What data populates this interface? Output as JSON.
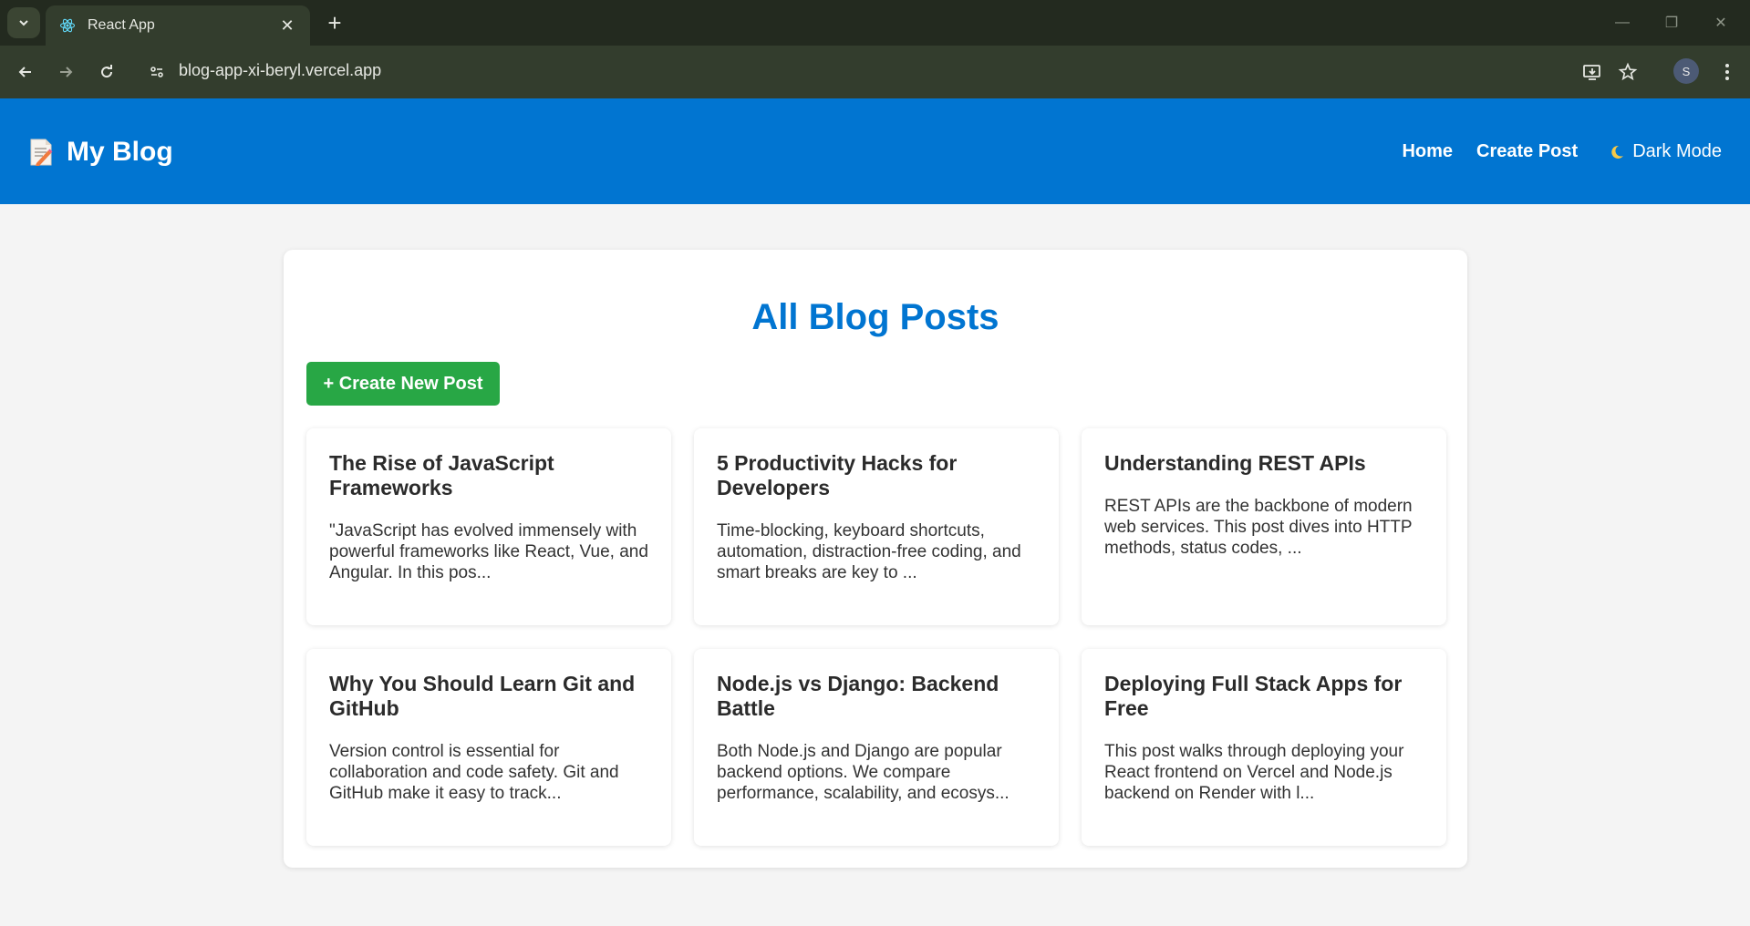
{
  "browser": {
    "tab_title": "React App",
    "url": "blog-app-xi-beryl.vercel.app",
    "profile_initial": "S"
  },
  "header": {
    "brand": "My Blog",
    "nav": {
      "home": "Home",
      "create_post": "Create Post",
      "dark_mode": "Dark Mode"
    }
  },
  "main": {
    "title": "All Blog Posts",
    "create_button": "+ Create New Post",
    "posts": [
      {
        "title": "The Rise of JavaScript Frameworks",
        "excerpt": "\"JavaScript has evolved immensely with powerful frameworks like React, Vue, and Angular. In this pos..."
      },
      {
        "title": "5 Productivity Hacks for Developers",
        "excerpt": "Time-blocking, keyboard shortcuts, automation, distraction-free coding, and smart breaks are key to ..."
      },
      {
        "title": "Understanding REST APIs",
        "excerpt": "REST APIs are the backbone of modern web services. This post dives into HTTP methods, status codes, ..."
      },
      {
        "title": "Why You Should Learn Git and GitHub",
        "excerpt": "Version control is essential for collaboration and code safety. Git and GitHub make it easy to track..."
      },
      {
        "title": "Node.js vs Django: Backend Battle",
        "excerpt": "Both Node.js and Django are popular backend options. We compare performance, scalability, and ecosys..."
      },
      {
        "title": "Deploying Full Stack Apps for Free",
        "excerpt": "This post walks through deploying your React frontend on Vercel and Node.js backend on Render with l..."
      }
    ]
  },
  "colors": {
    "header_bg": "#0175d1",
    "title_color": "#0175d1",
    "create_button_bg": "#28a745",
    "page_bg": "#f4f4f4"
  }
}
